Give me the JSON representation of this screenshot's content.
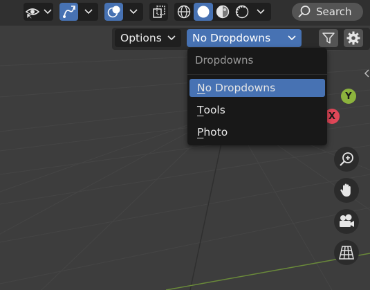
{
  "header": {
    "visibility_icon": "eye-pointer-icon",
    "selectability_icon": "curve-tool-icon",
    "overlays_icon": "overlays-icon",
    "xray_icon": "xray-icon",
    "shading_modes": [
      "wireframe-icon",
      "solid-icon",
      "material-icon",
      "rendered-icon"
    ],
    "active_shading": "solid",
    "search_label": "Search"
  },
  "toolbar2": {
    "options_label": "Options",
    "dropdown_value": "No Dropdowns",
    "filter_icon": "funnel-icon",
    "settings_icon": "gear-icon"
  },
  "menu": {
    "title": "Dropdowns",
    "items": [
      {
        "first": "N",
        "rest": "o Dropdowns",
        "selected": true
      },
      {
        "first": "T",
        "rest": "ools",
        "selected": false
      },
      {
        "first": "P",
        "rest": "hoto",
        "selected": false
      }
    ]
  },
  "gizmo": {
    "y_label": "Y",
    "x_label": "X",
    "y_color": "#8cb33d",
    "x_color": "#e04758",
    "buttons": [
      "zoom-icon",
      "hand-icon",
      "camera-icon",
      "perspective-grid-icon"
    ]
  },
  "colors": {
    "accent": "#4772b3",
    "background": "#3d3d3d",
    "grid": "#4a4a4a",
    "x_axis_line": "#6a8a3a"
  }
}
